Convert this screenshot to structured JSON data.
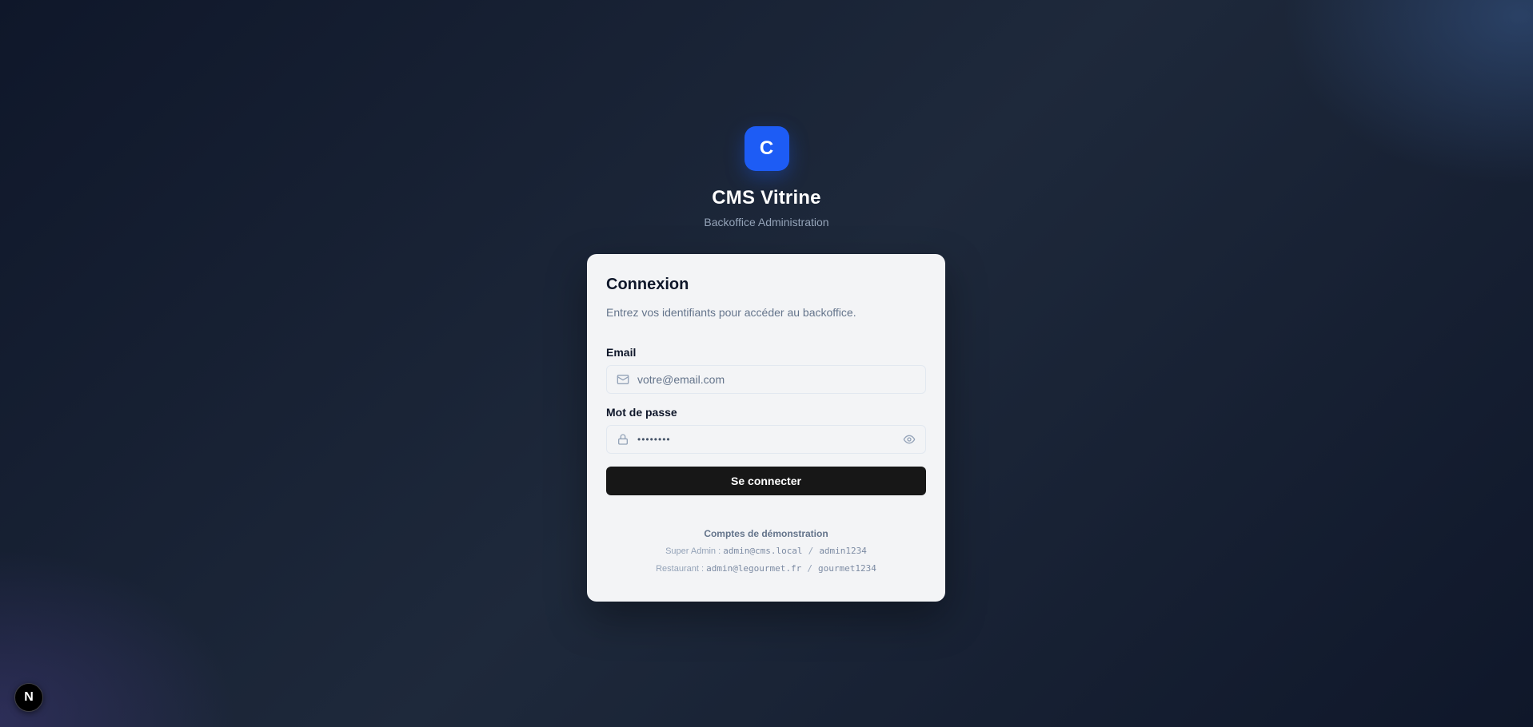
{
  "brand": {
    "logo_letter": "C",
    "title": "CMS Vitrine",
    "subtitle": "Backoffice Administration",
    "accent_color": "#1d5cf5"
  },
  "login": {
    "title": "Connexion",
    "description": "Entrez vos identifiants pour accéder au backoffice.",
    "email": {
      "label": "Email",
      "placeholder": "votre@email.com",
      "value": "",
      "icon": "mail-icon"
    },
    "password": {
      "label": "Mot de passe",
      "masked_value": "••••••••",
      "icon": "lock-icon",
      "toggle_icon": "eye-icon"
    },
    "submit_label": "Se connecter"
  },
  "demo_accounts": {
    "title": "Comptes de démonstration",
    "accounts": [
      {
        "role": "Super Admin :",
        "email": "admin@cms.local",
        "separator": "/",
        "password": "admin1234"
      },
      {
        "role": "Restaurant :",
        "email": "admin@legourmet.fr",
        "separator": "/",
        "password": "gourmet1234"
      }
    ]
  },
  "dev_badge": {
    "letter": "N",
    "icon": "nextjs-icon"
  }
}
